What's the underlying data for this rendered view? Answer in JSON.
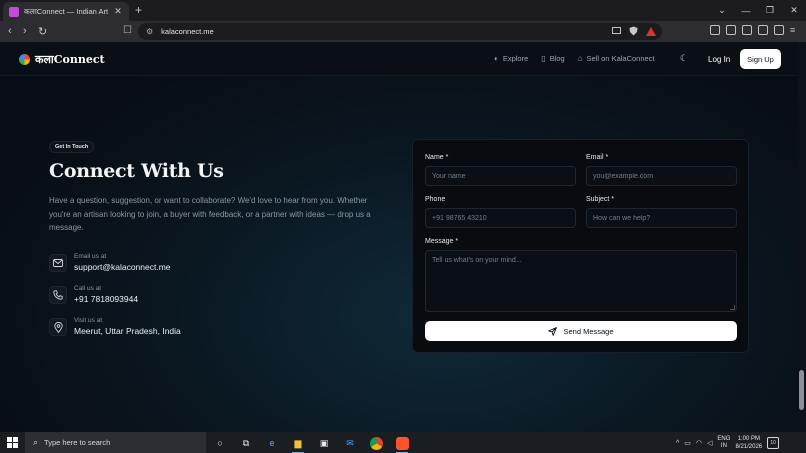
{
  "browser": {
    "tab_title": "कलाConnect — Indian Art Marketplace",
    "url": "kalaconnect.me"
  },
  "site": {
    "logo_text": "कलाConnect",
    "nav": [
      {
        "label": "Explore",
        "icon": "palette-icon"
      },
      {
        "label": "Blog",
        "icon": "book-icon"
      },
      {
        "label": "Sell on KalaConnect",
        "icon": "store-icon"
      }
    ],
    "login": "Log In",
    "signup": "Sign Up"
  },
  "section": {
    "eyebrow": "Get In Touch",
    "heading": "Connect With Us",
    "lead": "Have a question, suggestion, or want to collaborate? We'd love to hear from you. Whether you're an artisan looking to join, a buyer with feedback, or a partner with ideas — drop us a message.",
    "contacts": [
      {
        "label": "Email us at",
        "value": "support@kalaconnect.me",
        "icon": "mail-icon"
      },
      {
        "label": "Call us at",
        "value": "+91 7818093944",
        "icon": "phone-icon"
      },
      {
        "label": "Visit us at",
        "value": "Meerut, Uttar Pradesh, India",
        "icon": "location-pin-icon"
      }
    ]
  },
  "form": {
    "name_label": "Name *",
    "name_placeholder": "Your name",
    "email_label": "Email *",
    "email_placeholder": "you@example.com",
    "phone_label": "Phone",
    "phone_placeholder": "+91 98765 43210",
    "subject_label": "Subject *",
    "subject_placeholder": "How can we help?",
    "message_label": "Message *",
    "message_placeholder": "Tell us what's on your mind...",
    "submit_label": "Send Message"
  },
  "taskbar": {
    "search_placeholder": "Type here to search",
    "lang_top": "ENG",
    "lang_bottom": "IN",
    "time": "1:00 PM",
    "date": "8/21/2026",
    "notification_count": "10"
  }
}
